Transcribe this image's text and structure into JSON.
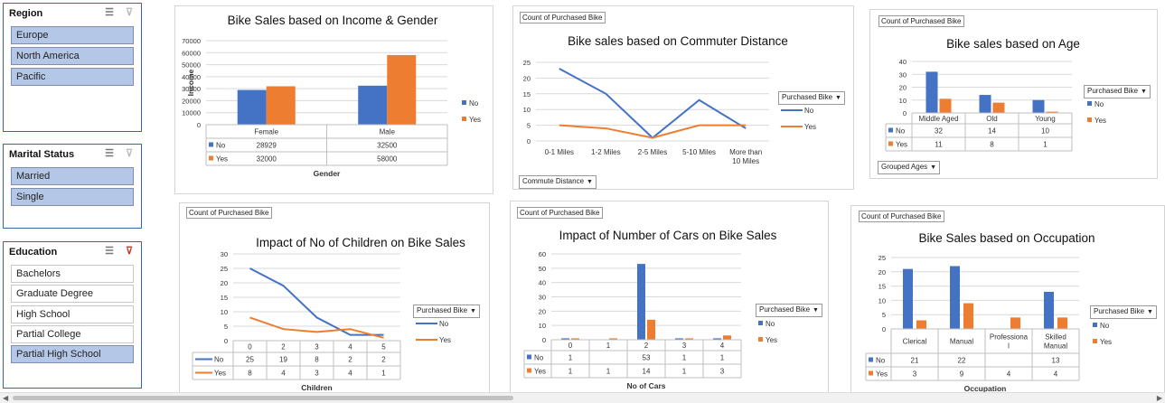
{
  "slicers": {
    "region": {
      "title": "Region",
      "items": [
        {
          "label": "Europe",
          "selected": true
        },
        {
          "label": "North America",
          "selected": true
        },
        {
          "label": "Pacific",
          "selected": true
        }
      ]
    },
    "marital": {
      "title": "Marital Status",
      "items": [
        {
          "label": "Married",
          "selected": true
        },
        {
          "label": "Single",
          "selected": true
        }
      ]
    },
    "education": {
      "title": "Education",
      "items": [
        {
          "label": "Bachelors",
          "selected": false
        },
        {
          "label": "Graduate Degree",
          "selected": false
        },
        {
          "label": "High School",
          "selected": false
        },
        {
          "label": "Partial College",
          "selected": false
        },
        {
          "label": "Partial High School",
          "selected": true
        }
      ]
    },
    "icons": {
      "multiselect": "multi-select-icon",
      "clear": "clear-filter-icon"
    }
  },
  "colors": {
    "no": "#4472c4",
    "yes": "#ed7d31",
    "grid": "#d9d9d9",
    "slicer_border": "#3c63a8",
    "slicer_selected": "#b4c7e7"
  },
  "common": {
    "field_button": "Count of Purchased Bike",
    "legend_button": "Purchased Bike",
    "series_no": "No",
    "series_yes": "Yes"
  },
  "chart_data": [
    {
      "id": "income",
      "type": "bar",
      "title": "Bike Sales based on Income & Gender",
      "xlabel": "Gender",
      "ylabel": "Income",
      "ylim": [
        0,
        70000
      ],
      "yticks": [
        "70000",
        "60000",
        "50000",
        "40000",
        "30000",
        "20000",
        "10000",
        "0"
      ],
      "categories": [
        "Female",
        "Male"
      ],
      "series": [
        {
          "name": "No",
          "values": [
            28929,
            32500
          ],
          "labels": [
            "28929",
            "32500"
          ]
        },
        {
          "name": "Yes",
          "values": [
            32000,
            58000
          ],
          "labels": [
            "32000",
            "58000"
          ]
        }
      ],
      "legend": "right",
      "grid": true
    },
    {
      "id": "commute",
      "type": "line",
      "title": "Bike sales based on Commuter Distance",
      "ylim": [
        0,
        25
      ],
      "yticks": [
        "25",
        "20",
        "15",
        "10",
        "5",
        "0"
      ],
      "categories": [
        "0-1 Miles",
        "1-2 Miles",
        "2-5 Miles",
        "5-10 Miles",
        "More than 10 Miles"
      ],
      "series": [
        {
          "name": "No",
          "values": [
            23,
            15,
            1,
            13,
            4
          ]
        },
        {
          "name": "Yes",
          "values": [
            5,
            4,
            1,
            5,
            5
          ]
        }
      ],
      "axis_button": "Commute Distance",
      "legend": "right",
      "grid": true
    },
    {
      "id": "age",
      "type": "bar",
      "title": "Bike sales based on Age",
      "ylim": [
        0,
        40
      ],
      "yticks": [
        "40",
        "30",
        "20",
        "10",
        "0"
      ],
      "categories": [
        "Middle Aged",
        "Old",
        "Young"
      ],
      "series": [
        {
          "name": "No",
          "values": [
            32,
            14,
            10
          ],
          "labels": [
            "32",
            "14",
            "10"
          ]
        },
        {
          "name": "Yes",
          "values": [
            11,
            8,
            1
          ],
          "labels": [
            "11",
            "8",
            "1"
          ]
        }
      ],
      "axis_button": "Grouped Ages",
      "legend": "right",
      "grid": true
    },
    {
      "id": "children",
      "type": "line",
      "title": "Impact of No of Children on Bike Sales",
      "xlabel": "Children",
      "ylim": [
        0,
        30
      ],
      "yticks": [
        "30",
        "25",
        "20",
        "15",
        "10",
        "5",
        "0"
      ],
      "categories": [
        "0",
        "2",
        "3",
        "4",
        "5"
      ],
      "series": [
        {
          "name": "No",
          "values": [
            25,
            19,
            8,
            2,
            2
          ],
          "labels": [
            "25",
            "19",
            "8",
            "2",
            "2"
          ]
        },
        {
          "name": "Yes",
          "values": [
            8,
            4,
            3,
            4,
            1
          ],
          "labels": [
            "8",
            "4",
            "3",
            "4",
            "1"
          ]
        }
      ],
      "legend": "right",
      "grid": true
    },
    {
      "id": "cars",
      "type": "bar",
      "title": "Impact of Number of Cars on Bike Sales",
      "xlabel": "No of Cars",
      "ylim": [
        0,
        60
      ],
      "yticks": [
        "60",
        "50",
        "40",
        "30",
        "20",
        "10",
        "0"
      ],
      "categories": [
        "0",
        "1",
        "2",
        "3",
        "4"
      ],
      "series": [
        {
          "name": "No",
          "values": [
            1,
            0,
            53,
            1,
            1
          ],
          "labels": [
            "1",
            "",
            "53",
            "1",
            "1"
          ]
        },
        {
          "name": "Yes",
          "values": [
            1,
            1,
            14,
            1,
            3
          ],
          "labels": [
            "1",
            "1",
            "14",
            "1",
            "3"
          ]
        }
      ],
      "legend": "right",
      "grid": true
    },
    {
      "id": "occupation",
      "type": "bar",
      "title": "Bike Sales based on Occupation",
      "xlabel": "Occupation",
      "ylim": [
        0,
        25
      ],
      "yticks": [
        "25",
        "20",
        "15",
        "10",
        "5",
        "0"
      ],
      "categories": [
        "Clerical",
        "Manual",
        "Professional",
        "Skilled Manual"
      ],
      "category_lines": [
        [
          "Clerical"
        ],
        [
          "Manual"
        ],
        [
          "Professiona",
          "l"
        ],
        [
          "Skilled",
          "Manual"
        ]
      ],
      "series": [
        {
          "name": "No",
          "values": [
            21,
            22,
            0,
            13
          ],
          "labels": [
            "21",
            "22",
            "",
            "13"
          ]
        },
        {
          "name": "Yes",
          "values": [
            3,
            9,
            4,
            4
          ],
          "labels": [
            "3",
            "9",
            "4",
            "4"
          ]
        }
      ],
      "legend": "right",
      "grid": true
    }
  ]
}
